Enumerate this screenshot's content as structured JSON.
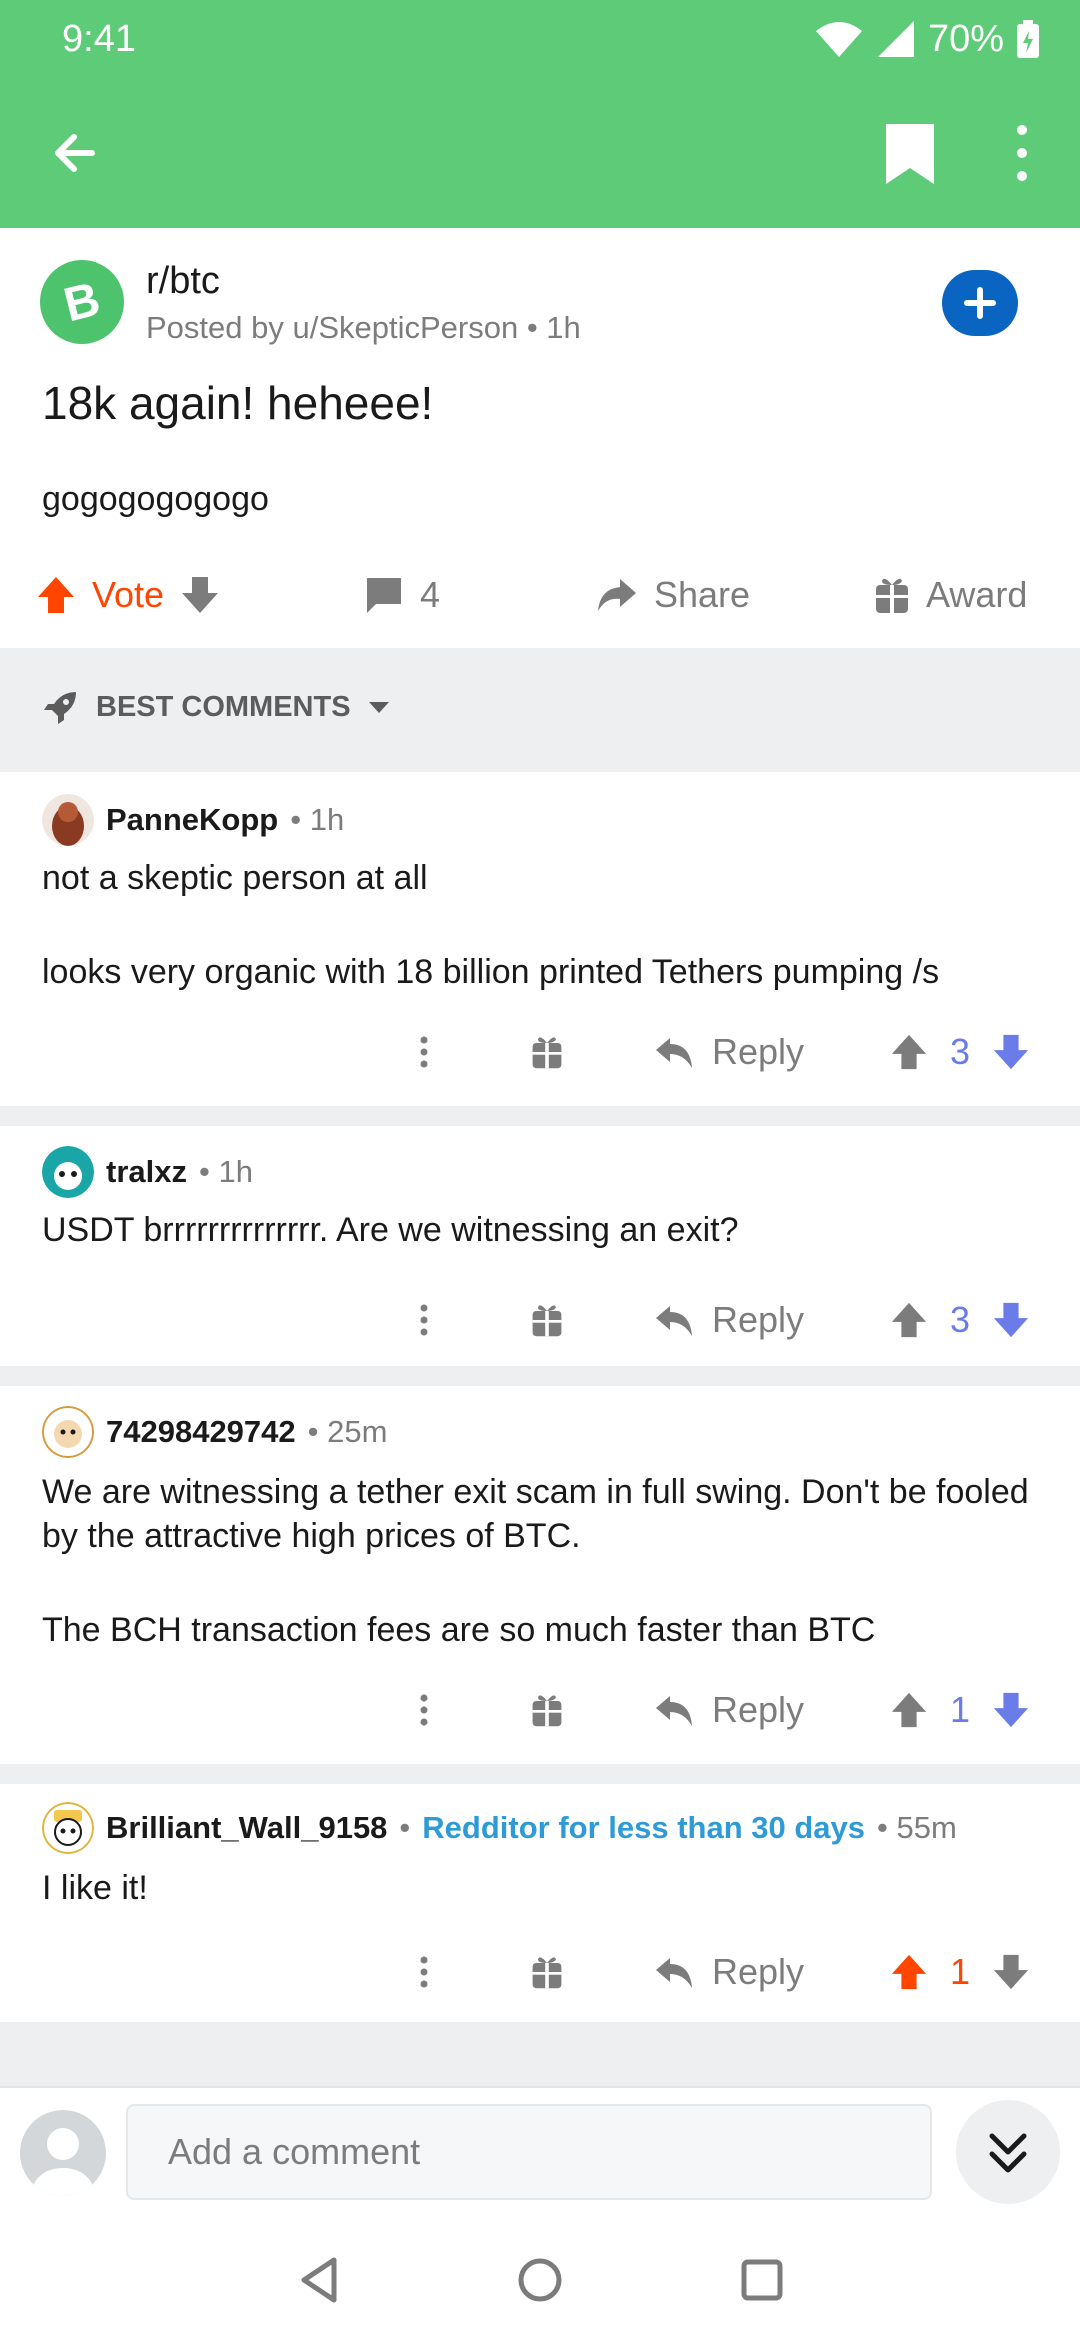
{
  "status": {
    "time": "9:41",
    "battery": "70%"
  },
  "appbar": {
    "back_icon": "arrow-left-icon",
    "bookmark_icon": "bookmark-icon",
    "more_icon": "more-vertical-icon"
  },
  "post": {
    "subreddit": "r/btc",
    "posted_by": "Posted by u/SkepticPerson • 1h",
    "title": "18k again! heheee!",
    "body": "gogogogogogo",
    "vote_label": "Vote",
    "comment_count": "4",
    "share_label": "Share",
    "award_label": "Award"
  },
  "sort": {
    "label": "BEST COMMENTS"
  },
  "comments": [
    {
      "author": "PanneKopp",
      "time": "• 1h",
      "text1": "not a skeptic person at all",
      "text2": "looks very organic with 18 billion printed Tethers pumping /s",
      "reply": "Reply",
      "score": "3"
    },
    {
      "author": "tralxz",
      "time": "• 1h",
      "text1": "USDT brrrrrrrrrrrrrr. Are we witnessing an exit?",
      "reply": "Reply",
      "score": "3"
    },
    {
      "author": "74298429742",
      "time": "• 25m",
      "text1": "We are witnessing a tether exit scam in full swing. Don't be fooled by the attractive high prices of BTC.",
      "text2": "The BCH transaction fees are so much faster than BTC",
      "reply": "Reply",
      "score": "1"
    },
    {
      "author": "Brilliant_Wall_9158",
      "sep": "•",
      "flair": "Redditor for less than 30 days",
      "time": "• 55m",
      "text1": "I like it!",
      "reply": "Reply",
      "score": "1"
    }
  ],
  "composer": {
    "placeholder": "Add a comment"
  },
  "colors": {
    "header": "#5ecb78",
    "upvote": "#ff4500",
    "vote_blue": "#6a7ce8",
    "join": "#0a64c2",
    "flair": "#2e9bd6"
  }
}
